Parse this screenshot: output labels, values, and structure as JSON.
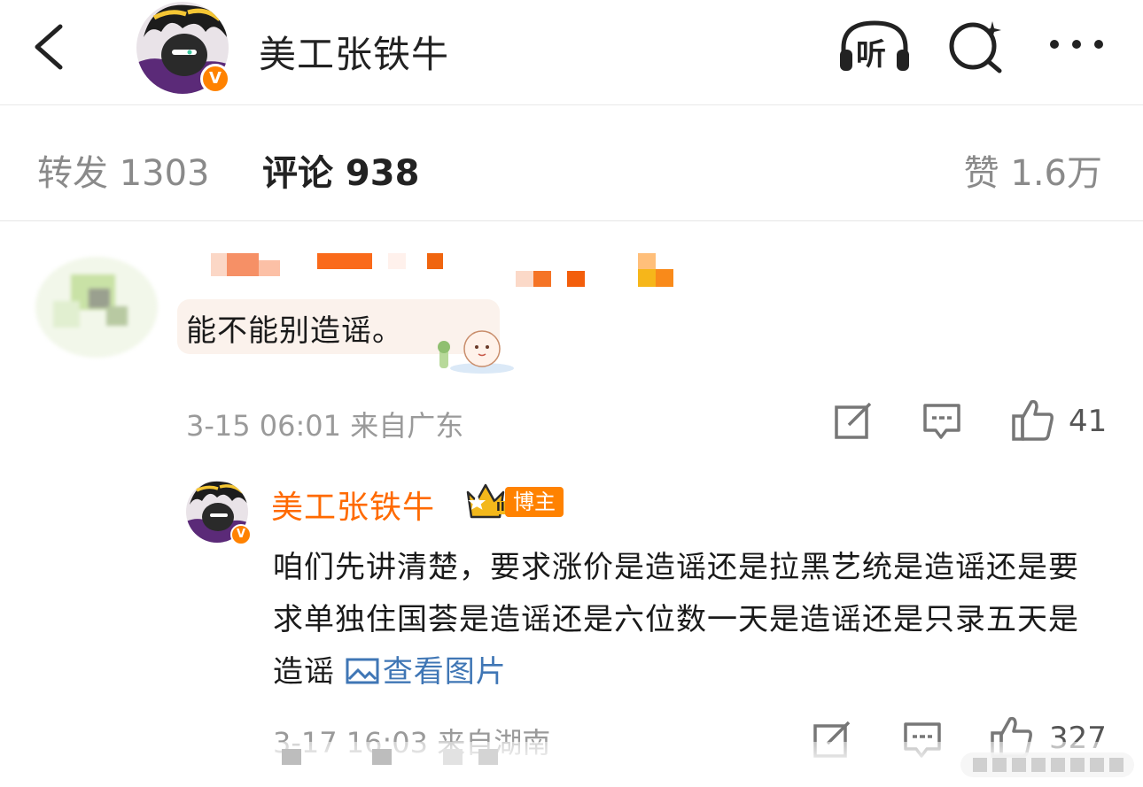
{
  "header": {
    "title": "美工张铁牛",
    "listen_label": "听",
    "verified_mark": "V",
    "icons": [
      "back-chevron-icon",
      "headphones-icon",
      "search-icon",
      "more-icon"
    ]
  },
  "stats": {
    "repost": "转发 1303",
    "comment": "评论 938",
    "like": "赞 1.6万"
  },
  "comments": [
    {
      "text": "能不能别造谣。",
      "meta": "3-15 06:01 来自广东",
      "likes": "41"
    }
  ],
  "reply": {
    "author": "美工张铁牛",
    "crown_level": "II",
    "badge": "博主",
    "text": "咱们先讲清楚，要求涨价是造谣还是拉黑艺统是造谣还是要求单独住国荟是造谣还是六位数一天是造谣还是只录五天是造谣",
    "view_pic": "查看图片",
    "meta": "3-17 16:03 来自湖南",
    "likes": "327"
  },
  "colors": {
    "accent_orange": "#ff6a00",
    "link_blue": "#3f76b5",
    "muted_gray": "#9a9a9a"
  }
}
